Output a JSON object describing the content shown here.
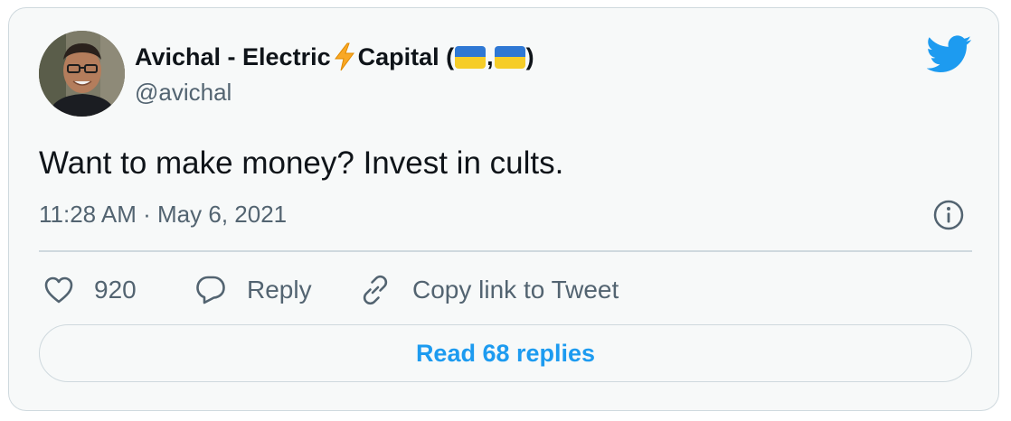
{
  "author": {
    "name_prefix": "Avichal - Electric",
    "name_suffix": "Capital (",
    "name_comma": ", ",
    "name_close": ")",
    "handle": "@avichal",
    "avatar_icon": "profile-photo",
    "emoji_bolt": "lightning-bolt",
    "emoji_flag": "ukraine-flag"
  },
  "tweet": {
    "text": "Want to make money? Invest in cults.",
    "timestamp": "11:28 AM · May 6, 2021"
  },
  "actions": {
    "like_count": "920",
    "reply_label": "Reply",
    "copy_label": "Copy link to Tweet"
  },
  "footer": {
    "read_replies_label": "Read 68 replies"
  },
  "colors": {
    "brand_blue": "#1d9bf0",
    "text_primary": "#0f1419",
    "text_secondary": "#536471",
    "border": "#cfd9de",
    "card_bg": "#f7f9f9"
  }
}
